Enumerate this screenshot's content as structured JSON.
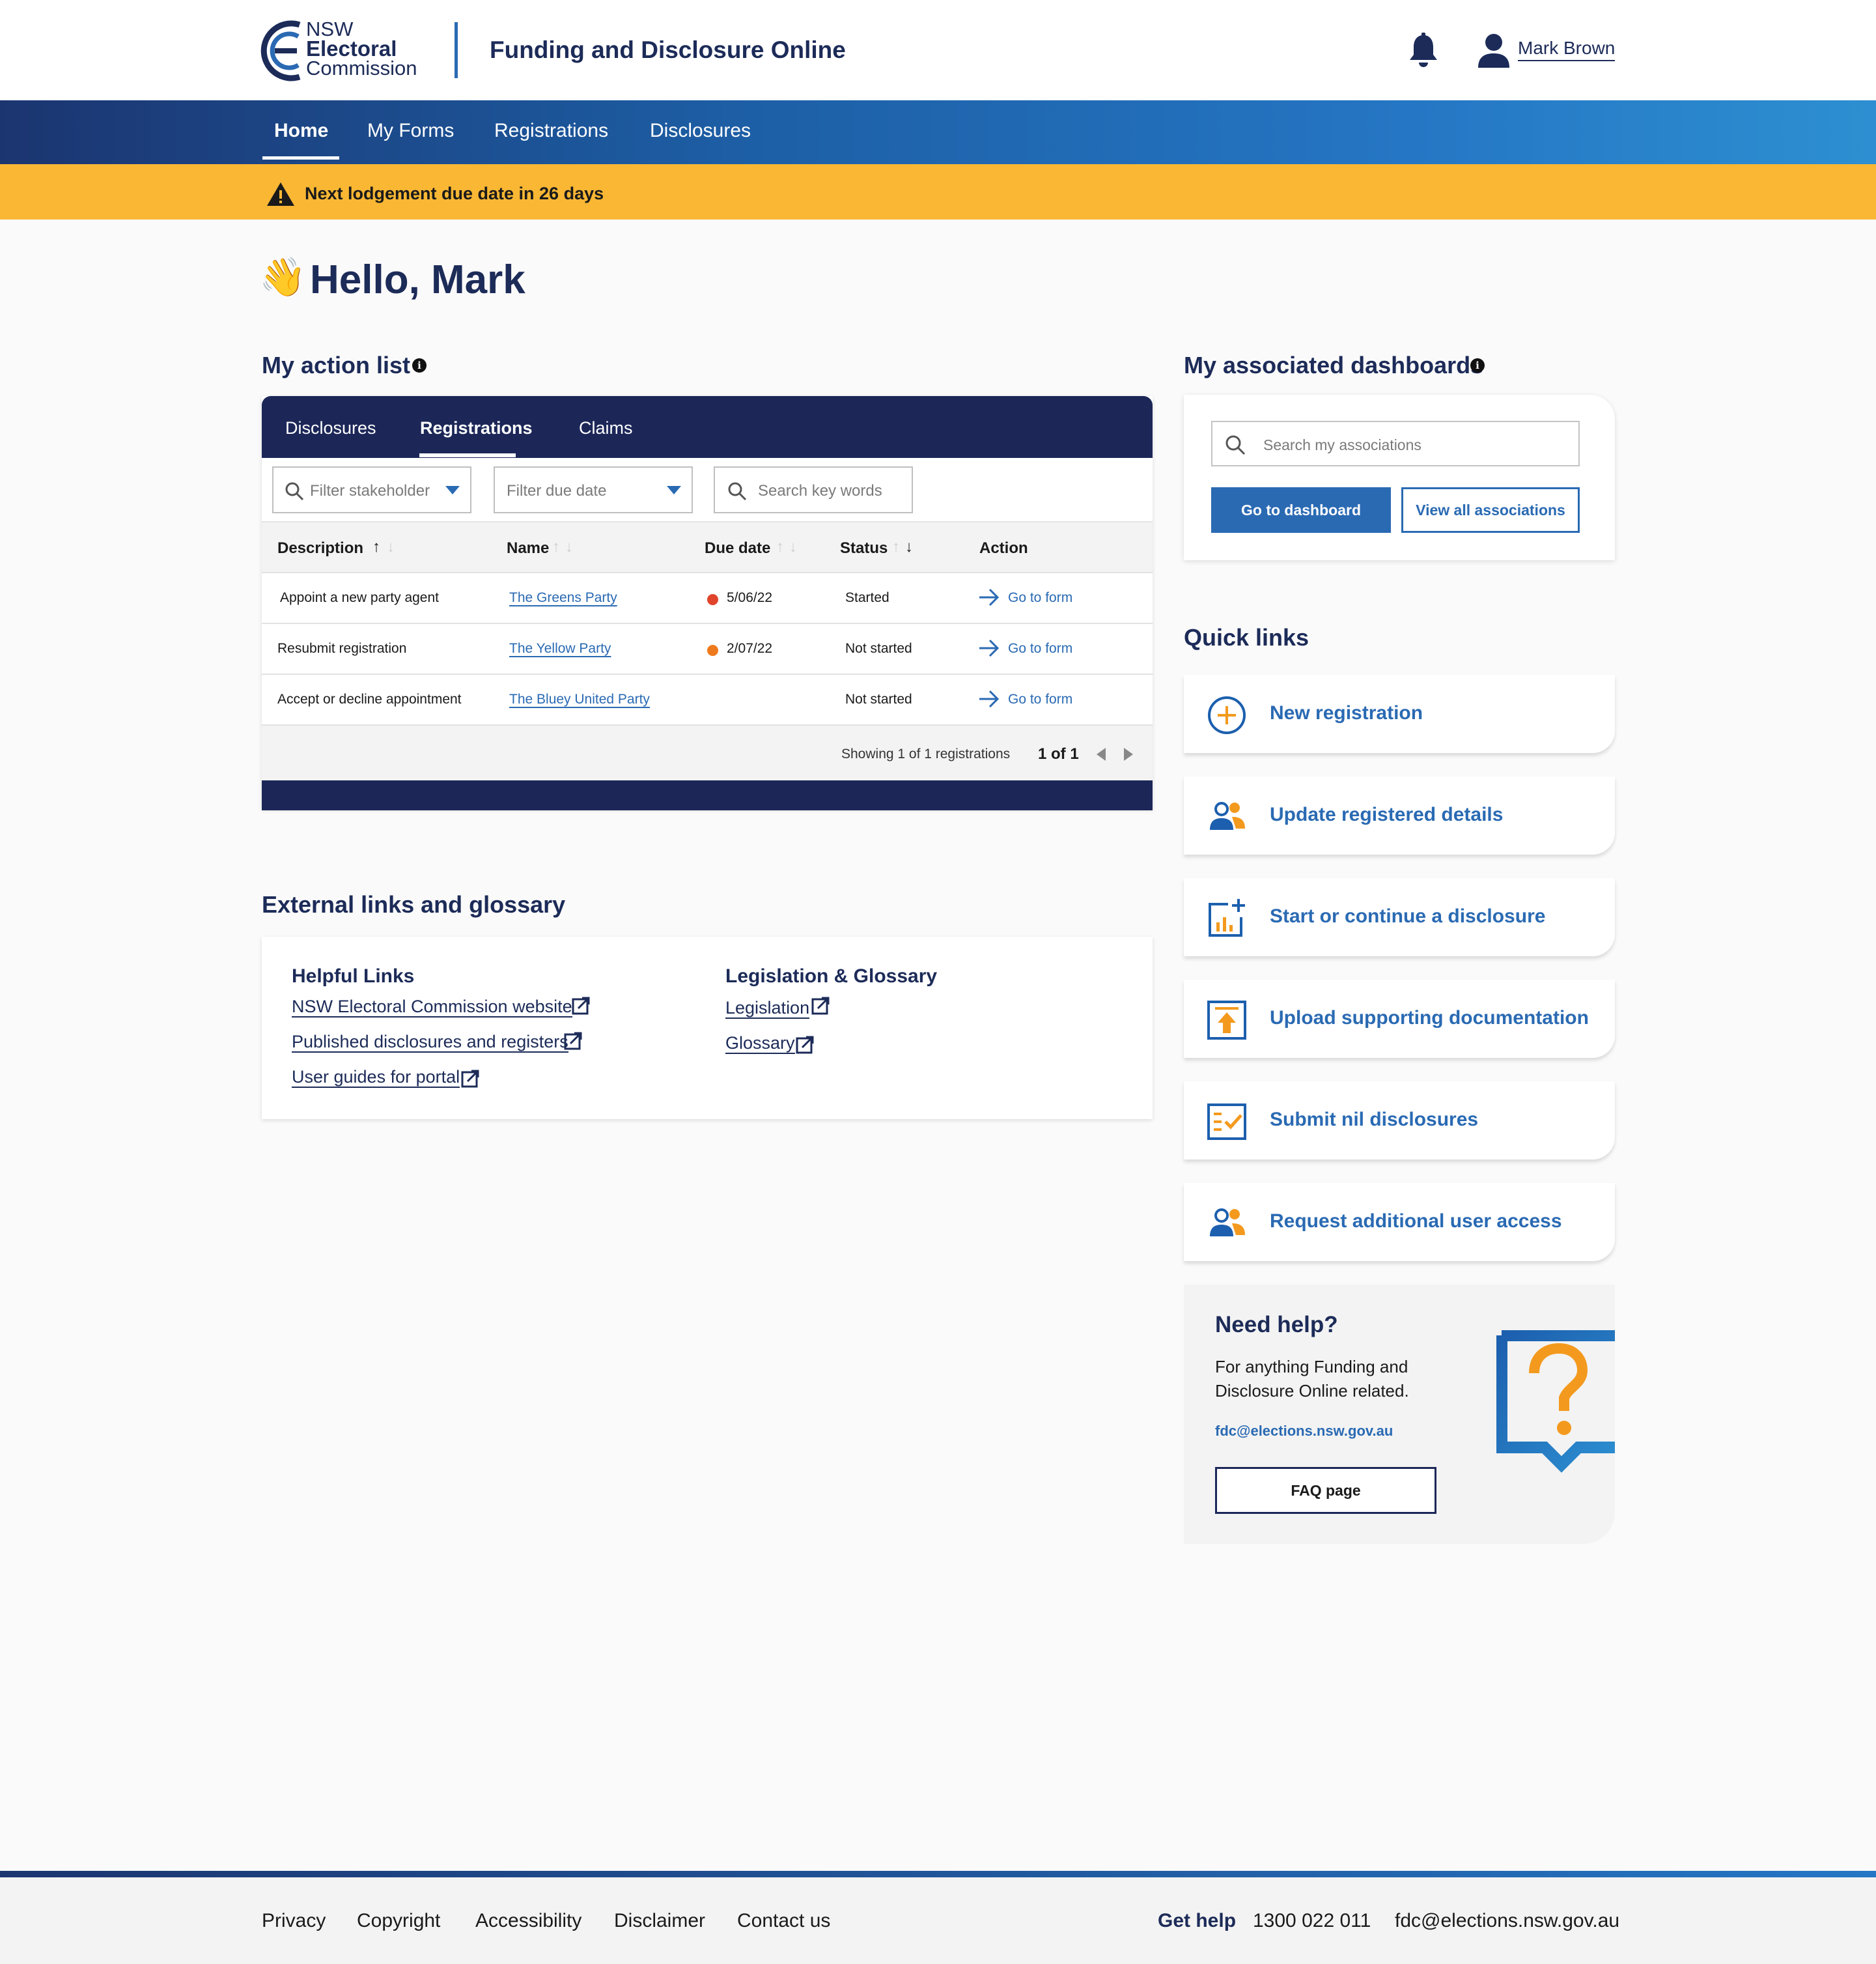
{
  "header": {
    "logo": {
      "line1": "NSW",
      "line2": "Electoral",
      "line3": "Commission"
    },
    "app_title": "Funding and Disclosure Online",
    "user_name": "Mark Brown"
  },
  "nav": {
    "items": [
      {
        "label": "Home",
        "active": true
      },
      {
        "label": "My Forms"
      },
      {
        "label": "Registrations"
      },
      {
        "label": "Disclosures"
      }
    ]
  },
  "alert": {
    "text": "Next lodgement due date in 26 days"
  },
  "greeting": {
    "emoji": "👋",
    "text": "Hello, Mark"
  },
  "action_list": {
    "title": "My action list",
    "tabs": [
      {
        "label": "Disclosures"
      },
      {
        "label": "Registrations",
        "active": true
      },
      {
        "label": "Claims"
      }
    ],
    "filters": {
      "stakeholder": "Filter stakeholder",
      "due_date": "Filter due date",
      "search": "Search key words"
    },
    "columns": [
      "Description",
      "Name",
      "Due date",
      "Status",
      "Action"
    ],
    "rows": [
      {
        "description": "Appoint a new party agent",
        "name": "The Greens Party",
        "due_date": "5/06/22",
        "due_color": "#e0442a",
        "status": "Started",
        "action": "Go to form"
      },
      {
        "description": "Resubmit registration",
        "name": "The Yellow Party",
        "due_date": "2/07/22",
        "due_color": "#ee7a1e",
        "status": "Not started",
        "action": "Go to form"
      },
      {
        "description": "Accept or decline appointment",
        "name": "The Bluey United Party",
        "due_date": "",
        "status": "Not started",
        "action": "Go to form"
      }
    ],
    "footer": {
      "showing": "Showing 1 of 1 registrations",
      "pages": "1 of 1"
    }
  },
  "dashboards": {
    "title": "My associated dashboards",
    "search_placeholder": "Search my associations",
    "go_button": "Go to dashboard",
    "view_all_button": "View all associations"
  },
  "quick_links": {
    "title": "Quick links",
    "items": [
      {
        "label": "New registration",
        "icon": "plus-circle-icon"
      },
      {
        "label": "Update registered details",
        "icon": "users-icon"
      },
      {
        "label": "Start or continue a disclosure",
        "icon": "chart-add-icon"
      },
      {
        "label": "Upload supporting documentation",
        "icon": "upload-icon"
      },
      {
        "label": "Submit nil disclosures",
        "icon": "checklist-icon"
      },
      {
        "label": "Request additional user access",
        "icon": "users-icon"
      }
    ]
  },
  "help": {
    "title": "Need help?",
    "body": "For anything Funding and Disclosure Online related.",
    "email": "fdc@elections.nsw.gov.au",
    "faq_button": "FAQ page"
  },
  "external": {
    "title": "External links and glossary",
    "helpful": {
      "heading": "Helpful Links",
      "links": [
        "NSW Electoral Commission website",
        "Published disclosures and registers",
        "User guides for portal"
      ]
    },
    "legislation": {
      "heading": "Legislation & Glossary",
      "links": [
        "Legislation",
        "Glossary"
      ]
    }
  },
  "footer": {
    "links": [
      "Privacy",
      "Copyright",
      "Accessibility",
      "Disclaimer",
      "Contact us"
    ],
    "get_help": "Get help",
    "phone": "1300 022 011",
    "email": "fdc@elections.nsw.gov.au"
  },
  "colors": {
    "navy": "#1c2758",
    "brand_blue": "#2a6ab3",
    "alert": "#f9b734",
    "orange_accent": "#f39a1e"
  }
}
